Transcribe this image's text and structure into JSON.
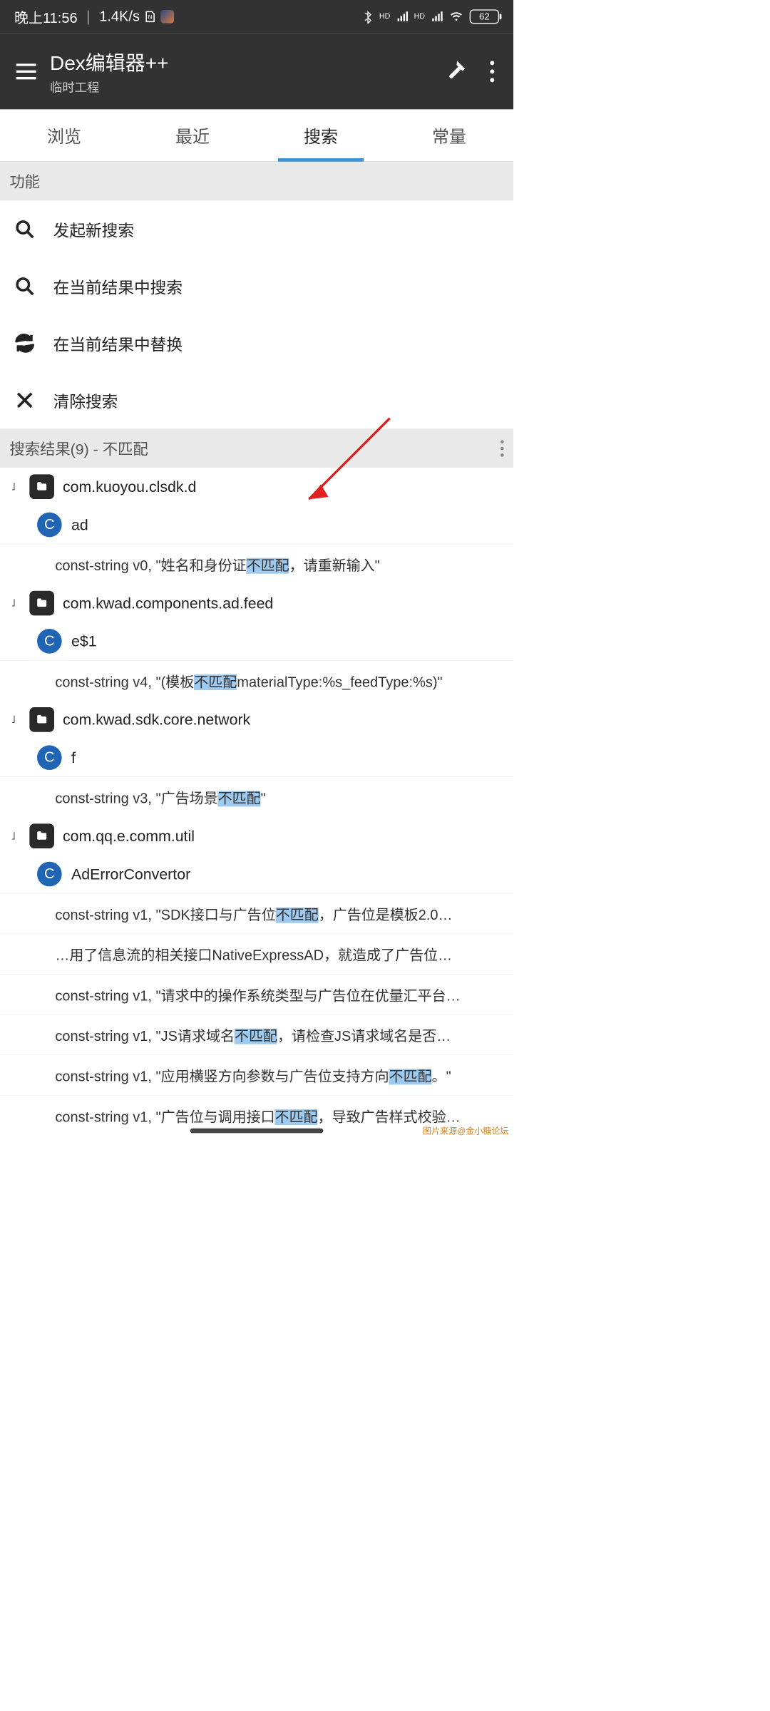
{
  "status": {
    "time": "晚上11:56",
    "net": "1.4K/s",
    "battery": "62"
  },
  "toolbar": {
    "title": "Dex编辑器++",
    "subtitle": "临时工程"
  },
  "tabs": [
    "浏览",
    "最近",
    "搜索",
    "常量"
  ],
  "activeTab": 2,
  "funcHeader": "功能",
  "funcs": {
    "newSearch": "发起新搜索",
    "searchInResults": "在当前结果中搜索",
    "replaceInResults": "在当前结果中替换",
    "clearSearch": "清除搜索"
  },
  "resultsHeader": "搜索结果(9) - 不匹配",
  "highlight": "不匹配",
  "results": [
    {
      "pkg": "com.kuoyou.clsdk.d",
      "cls": "ad",
      "lines": [
        {
          "pre": "const-string v0, \"姓名和身份证",
          "hl": "不匹配",
          "post": "，请重新输入\""
        }
      ]
    },
    {
      "pkg": "com.kwad.components.ad.feed",
      "cls": "e$1",
      "lines": [
        {
          "pre": "const-string v4, \"(模板",
          "hl": "不匹配",
          "post": "materialType:%s_feedType:%s)\""
        }
      ]
    },
    {
      "pkg": "com.kwad.sdk.core.network",
      "cls": "f",
      "lines": [
        {
          "pre": "const-string v3, \"广告场景",
          "hl": "不匹配",
          "post": "\""
        }
      ]
    },
    {
      "pkg": "com.qq.e.comm.util",
      "cls": "AdErrorConvertor",
      "lines": [
        {
          "pre": "const-string v1, \"SDK接口与广告位",
          "hl": "不匹配",
          "post": "，广告位是模板2.0…"
        },
        {
          "pre": "…用了信息流的相关接口NativeExpressAD，就造成了广告位…",
          "hl": "",
          "post": ""
        },
        {
          "pre": "const-string v1, \"请求中的操作系统类型与广告位在优量汇平台…",
          "hl": "",
          "post": ""
        },
        {
          "pre": "const-string v1, \"JS请求域名",
          "hl": "不匹配",
          "post": "，请检查JS请求域名是否…"
        },
        {
          "pre": "const-string v1, \"应用横竖方向参数与广告位支持方向",
          "hl": "不匹配",
          "post": "。\""
        },
        {
          "pre": "const-string v1, \"广告位与调用接口",
          "hl": "不匹配",
          "post": "，导致广告样式校验…"
        }
      ]
    }
  ],
  "watermark": "图片来源@金小糖论坛"
}
